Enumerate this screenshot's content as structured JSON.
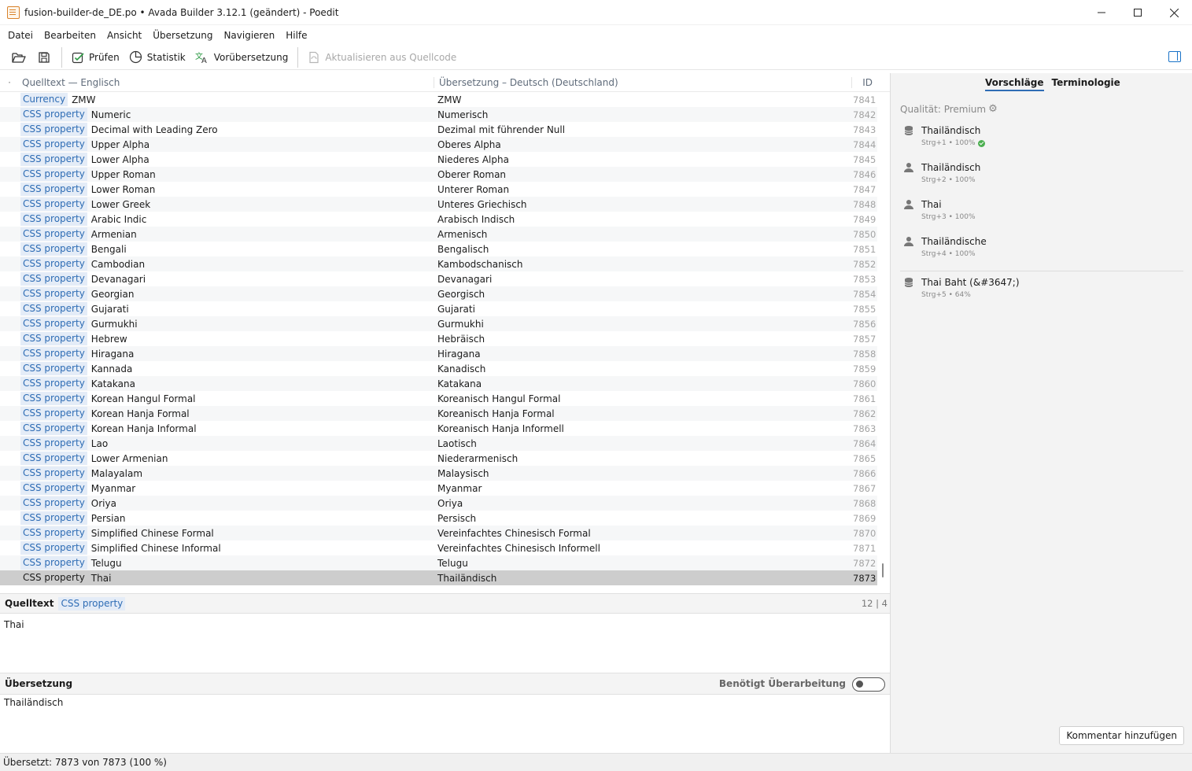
{
  "window": {
    "title": "fusion-builder-de_DE.po • Avada Builder 3.12.1 (geändert) - Poedit"
  },
  "menu": [
    "Datei",
    "Bearbeiten",
    "Ansicht",
    "Übersetzung",
    "Navigieren",
    "Hilfe"
  ],
  "toolbar": {
    "validate": "Prüfen",
    "stats": "Statistik",
    "pretranslate": "Vorübersetzung",
    "update_source": "Aktualisieren aus Quellcode"
  },
  "list": {
    "header_source": "Quelltext — Englisch",
    "header_translation": "Übersetzung – Deutsch (Deutschland)",
    "header_id": "ID",
    "rows": [
      {
        "ctx": "Currency",
        "src": "ZMW",
        "trans": "ZMW",
        "id": "7841"
      },
      {
        "ctx": "CSS property",
        "src": "Numeric",
        "trans": "Numerisch",
        "id": "7842"
      },
      {
        "ctx": "CSS property",
        "src": "Decimal with Leading Zero",
        "trans": "Dezimal mit führender Null",
        "id": "7843"
      },
      {
        "ctx": "CSS property",
        "src": "Upper Alpha",
        "trans": "Oberes Alpha",
        "id": "7844"
      },
      {
        "ctx": "CSS property",
        "src": "Lower Alpha",
        "trans": "Niederes Alpha",
        "id": "7845"
      },
      {
        "ctx": "CSS property",
        "src": "Upper Roman",
        "trans": "Oberer Roman",
        "id": "7846"
      },
      {
        "ctx": "CSS property",
        "src": "Lower Roman",
        "trans": "Unterer Roman",
        "id": "7847"
      },
      {
        "ctx": "CSS property",
        "src": "Lower Greek",
        "trans": "Unteres Griechisch",
        "id": "7848"
      },
      {
        "ctx": "CSS property",
        "src": "Arabic Indic",
        "trans": "Arabisch Indisch",
        "id": "7849"
      },
      {
        "ctx": "CSS property",
        "src": "Armenian",
        "trans": "Armenisch",
        "id": "7850"
      },
      {
        "ctx": "CSS property",
        "src": "Bengali",
        "trans": "Bengalisch",
        "id": "7851"
      },
      {
        "ctx": "CSS property",
        "src": "Cambodian",
        "trans": "Kambodschanisch",
        "id": "7852"
      },
      {
        "ctx": "CSS property",
        "src": "Devanagari",
        "trans": "Devanagari",
        "id": "7853"
      },
      {
        "ctx": "CSS property",
        "src": "Georgian",
        "trans": "Georgisch",
        "id": "7854"
      },
      {
        "ctx": "CSS property",
        "src": "Gujarati",
        "trans": "Gujarati",
        "id": "7855"
      },
      {
        "ctx": "CSS property",
        "src": "Gurmukhi",
        "trans": "Gurmukhi",
        "id": "7856"
      },
      {
        "ctx": "CSS property",
        "src": "Hebrew",
        "trans": "Hebräisch",
        "id": "7857"
      },
      {
        "ctx": "CSS property",
        "src": "Hiragana",
        "trans": "Hiragana",
        "id": "7858"
      },
      {
        "ctx": "CSS property",
        "src": "Kannada",
        "trans": "Kanadisch",
        "id": "7859"
      },
      {
        "ctx": "CSS property",
        "src": "Katakana",
        "trans": "Katakana",
        "id": "7860"
      },
      {
        "ctx": "CSS property",
        "src": "Korean Hangul Formal",
        "trans": "Koreanisch Hangul Formal",
        "id": "7861"
      },
      {
        "ctx": "CSS property",
        "src": "Korean Hanja Formal",
        "trans": "Koreanisch Hanja Formal",
        "id": "7862"
      },
      {
        "ctx": "CSS property",
        "src": "Korean Hanja Informal",
        "trans": "Koreanisch Hanja Informell",
        "id": "7863"
      },
      {
        "ctx": "CSS property",
        "src": "Lao",
        "trans": "Laotisch",
        "id": "7864"
      },
      {
        "ctx": "CSS property",
        "src": "Lower Armenian",
        "trans": "Niederarmenisch",
        "id": "7865"
      },
      {
        "ctx": "CSS property",
        "src": "Malayalam",
        "trans": "Malaysisch",
        "id": "7866"
      },
      {
        "ctx": "CSS property",
        "src": "Myanmar",
        "trans": "Myanmar",
        "id": "7867"
      },
      {
        "ctx": "CSS property",
        "src": "Oriya",
        "trans": "Oriya",
        "id": "7868"
      },
      {
        "ctx": "CSS property",
        "src": "Persian",
        "trans": "Persisch",
        "id": "7869"
      },
      {
        "ctx": "CSS property",
        "src": "Simplified Chinese Formal",
        "trans": "Vereinfachtes Chinesisch Formal",
        "id": "7870"
      },
      {
        "ctx": "CSS property",
        "src": "Simplified Chinese Informal",
        "trans": "Vereinfachtes Chinesisch Informell",
        "id": "7871"
      },
      {
        "ctx": "CSS property",
        "src": "Telugu",
        "trans": "Telugu",
        "id": "7872"
      },
      {
        "ctx": "CSS property",
        "src": "Thai",
        "trans": "Thailändisch",
        "id": "7873",
        "selected": true
      }
    ]
  },
  "source_editor": {
    "title": "Quelltext",
    "context": "CSS property",
    "count": "12 | 4",
    "text": "Thai"
  },
  "translation_editor": {
    "title": "Übersetzung",
    "needs_work_label": "Benötigt Überarbeitung",
    "needs_work_on": false,
    "text": "Thailändisch"
  },
  "status": "Übersetzt: 7873 von 7873 (100 %)",
  "sidebar": {
    "tabs": [
      "Vorschläge",
      "Terminologie"
    ],
    "quality": "Qualität: Premium",
    "suggestions": [
      {
        "icon": "database-icon",
        "text": "Thailändisch",
        "meta": "Strg+1 • 100%",
        "verified": true
      },
      {
        "icon": "person-icon",
        "text": "Thailändisch",
        "meta": "Strg+2 • 100%",
        "verified": false
      },
      {
        "icon": "person-icon",
        "text": "Thai",
        "meta": "Strg+3 • 100%",
        "verified": false
      },
      {
        "icon": "person-icon",
        "text": "Thailändische",
        "meta": "Strg+4 • 100%",
        "verified": false
      },
      {
        "icon": "database-icon",
        "text": "Thai Baht (&#3647;)",
        "meta": "Strg+5 • 64%",
        "verified": false
      }
    ],
    "add_comment": "Kommentar hinzufügen"
  },
  "colors": {
    "context_tag_bg": "#e4ecf7",
    "context_tag_fg": "#2f6db5",
    "selected_row": "#cdcdcd",
    "accent": "#1a73c8"
  }
}
